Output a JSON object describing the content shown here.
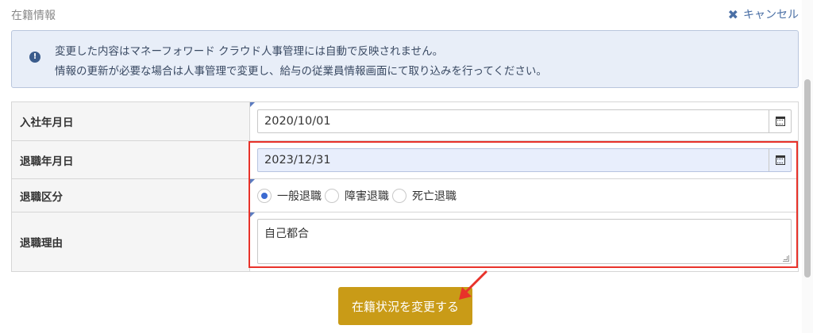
{
  "section": {
    "title": "在籍情報",
    "cancel_label": "キャンセル"
  },
  "notice": {
    "line1": "変更した内容はマネーフォワード クラウド人事管理には自動で反映されません。",
    "line2": "情報の更新が必要な場合は人事管理で変更し、給与の従業員情報画面にて取り込みを行ってください。",
    "icon": "exclamation-circle-icon"
  },
  "form": {
    "join_date": {
      "label": "入社年月日",
      "value": "2020/10/01"
    },
    "retire_date": {
      "label": "退職年月日",
      "value": "2023/12/31"
    },
    "retire_type": {
      "label": "退職区分",
      "options": [
        "一般退職",
        "障害退職",
        "死亡退職"
      ],
      "selected": "一般退職"
    },
    "retire_reason": {
      "label": "退職理由",
      "value": "自己都合"
    }
  },
  "submit_label": "在籍状況を変更する",
  "colors": {
    "accent": "#c99b17",
    "highlight_border": "#e8322a",
    "notice_bg": "#e8eef8",
    "link": "#4a6fa5"
  }
}
